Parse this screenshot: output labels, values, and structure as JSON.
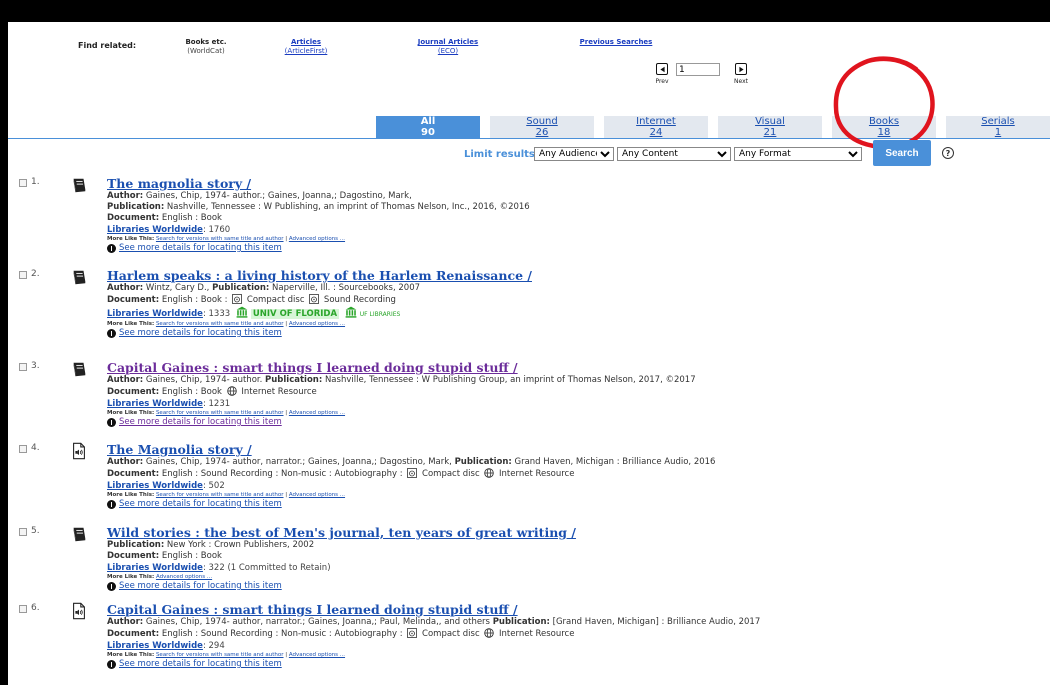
{
  "related": {
    "label": "Find related:",
    "books": {
      "head": "Books etc.",
      "sub": "(WorldCat)"
    },
    "articles": {
      "head": "Articles",
      "sub": "(ArticleFirst)"
    },
    "journal": {
      "head": "Journal Articles",
      "sub": "(ECO)"
    },
    "previous": "Previous Searches"
  },
  "pager": {
    "page": "1",
    "prev": "Prev",
    "next": "Next"
  },
  "tabs": [
    {
      "label": "All",
      "count": "90",
      "active": true
    },
    {
      "label": "Sound",
      "count": "26"
    },
    {
      "label": "Internet",
      "count": "24"
    },
    {
      "label": "Visual",
      "count": "21"
    },
    {
      "label": "Books",
      "count": "18",
      "circled": true
    },
    {
      "label": "Serials",
      "count": "1"
    }
  ],
  "limit": {
    "label": "Limit results:",
    "audience": "Any Audience",
    "content": "Any Content",
    "format": "Any Format",
    "search": "Search",
    "help": "?"
  },
  "results": [
    {
      "num": "1.",
      "icon": "book-icon",
      "title": "The magnolia story /",
      "lines": [
        [
          {
            "b": "Author:"
          },
          {
            "t": " Gaines, Chip, 1974- author.; Gaines, Joanna,; Dagostino, Mark,"
          }
        ],
        [
          {
            "b": "Publication:"
          },
          {
            "t": " Nashville, Tennessee : W Publishing, an imprint of Thomas Nelson, Inc., 2016, ©2016"
          }
        ],
        [
          {
            "b": "Document:"
          },
          {
            "t": " English : Book"
          }
        ]
      ],
      "lw_label": "Libraries Worldwide",
      "lw_value": ": 1760",
      "more_label": "More Like This:",
      "more_links": [
        "Search for versions with same title and author",
        "Advanced options ..."
      ],
      "see_more": "See more details for locating this item"
    },
    {
      "num": "2.",
      "icon": "book-icon",
      "title": "Harlem speaks : a living history of the Harlem Renaissance /",
      "lines": [
        [
          {
            "b": "Author:"
          },
          {
            "t": " Wintz, Cary D., "
          },
          {
            "b": "Publication:"
          },
          {
            "t": " Naperville, Ill. : Sourcebooks, 2007"
          }
        ],
        [
          {
            "b": "Document:"
          },
          {
            "t": " English : Book : "
          },
          {
            "i": "cd"
          },
          {
            "t": " Compact disc "
          },
          {
            "i": "cd"
          },
          {
            "t": " Sound Recording"
          }
        ]
      ],
      "lw_label": "Libraries Worldwide",
      "lw_value": ": 1333",
      "holding": "UNIV OF FLORIDA",
      "holding_small": "UF LIBRARIES",
      "more_label": "More Like This:",
      "more_links": [
        "Search for versions with same title and author",
        "Advanced options ..."
      ],
      "see_more": "See more details for locating this item"
    },
    {
      "num": "3.",
      "icon": "book-icon",
      "visited": true,
      "title": "Capital Gaines : smart things I learned doing stupid stuff /",
      "lines": [
        [
          {
            "b": "Author:"
          },
          {
            "t": " Gaines, Chip, 1974- author. "
          },
          {
            "b": "Publication:"
          },
          {
            "t": " Nashville, Tennessee : W Publishing Group, an imprint of Thomas Nelson, 2017, ©2017"
          }
        ],
        [
          {
            "b": "Document:"
          },
          {
            "t": " English : Book "
          },
          {
            "i": "globe"
          },
          {
            "t": " Internet Resource"
          }
        ]
      ],
      "lw_label": "Libraries Worldwide",
      "lw_value": ": 1231",
      "more_label": "More Like This:",
      "more_links": [
        "Search for versions with same title and author",
        "Advanced options ..."
      ],
      "see_more": "See more details for locating this item"
    },
    {
      "num": "4.",
      "icon": "audio-file-icon",
      "title": "The Magnolia story /",
      "lines": [
        [
          {
            "b": "Author:"
          },
          {
            "t": " Gaines, Chip, 1974- author, narrator.; Gaines, Joanna,; Dagostino, Mark, "
          },
          {
            "b": "Publication:"
          },
          {
            "t": " Grand Haven, Michigan : Brilliance Audio, 2016"
          }
        ],
        [
          {
            "b": "Document:"
          },
          {
            "t": " English : Sound Recording : Non-music : Autobiography : "
          },
          {
            "i": "cd"
          },
          {
            "t": " Compact disc "
          },
          {
            "i": "globe"
          },
          {
            "t": " Internet Resource"
          }
        ]
      ],
      "lw_label": "Libraries Worldwide",
      "lw_value": ": 502",
      "more_label": "More Like This:",
      "more_links": [
        "Search for versions with same title and author",
        "Advanced options ..."
      ],
      "see_more": "See more details for locating this item"
    },
    {
      "num": "5.",
      "icon": "book-icon",
      "title": "Wild stories : the best of Men's journal, ten years of great writing /",
      "lines": [
        [
          {
            "b": "Publication:"
          },
          {
            "t": " New York : Crown Publishers, 2002"
          }
        ],
        [
          {
            "b": "Document:"
          },
          {
            "t": " English : Book"
          }
        ]
      ],
      "lw_label": "Libraries Worldwide",
      "lw_value": ": 322 (1 Committed to Retain)",
      "more_label": "More Like This:",
      "more_links": [
        "Advanced options ..."
      ],
      "see_more": "See more details for locating this item"
    },
    {
      "num": "6.",
      "icon": "audio-file-icon",
      "title": "Capital Gaines : smart things I learned doing stupid stuff /",
      "lines": [
        [
          {
            "b": "Author:"
          },
          {
            "t": " Gaines, Chip, 1974- author, narrator.; Gaines, Joanna,; Paul, Melinda,, and others "
          },
          {
            "b": "Publication:"
          },
          {
            "t": " [Grand Haven, Michigan] : Brilliance Audio, 2017"
          }
        ],
        [
          {
            "b": "Document:"
          },
          {
            "t": " English : Sound Recording : Non-music : Autobiography : "
          },
          {
            "i": "cd"
          },
          {
            "t": " Compact disc "
          },
          {
            "i": "globe"
          },
          {
            "t": " Internet Resource"
          }
        ]
      ],
      "lw_label": "Libraries Worldwide",
      "lw_value": ": 294",
      "more_label": "More Like This:",
      "more_links": [
        "Search for versions with same title and author",
        "Advanced options ..."
      ],
      "see_more": "See more details for locating this item"
    }
  ],
  "colors": {
    "accent": "#4a90d9",
    "link": "#1a4fb0",
    "visited": "#6b2c9a",
    "annotation": "#e0141e"
  }
}
